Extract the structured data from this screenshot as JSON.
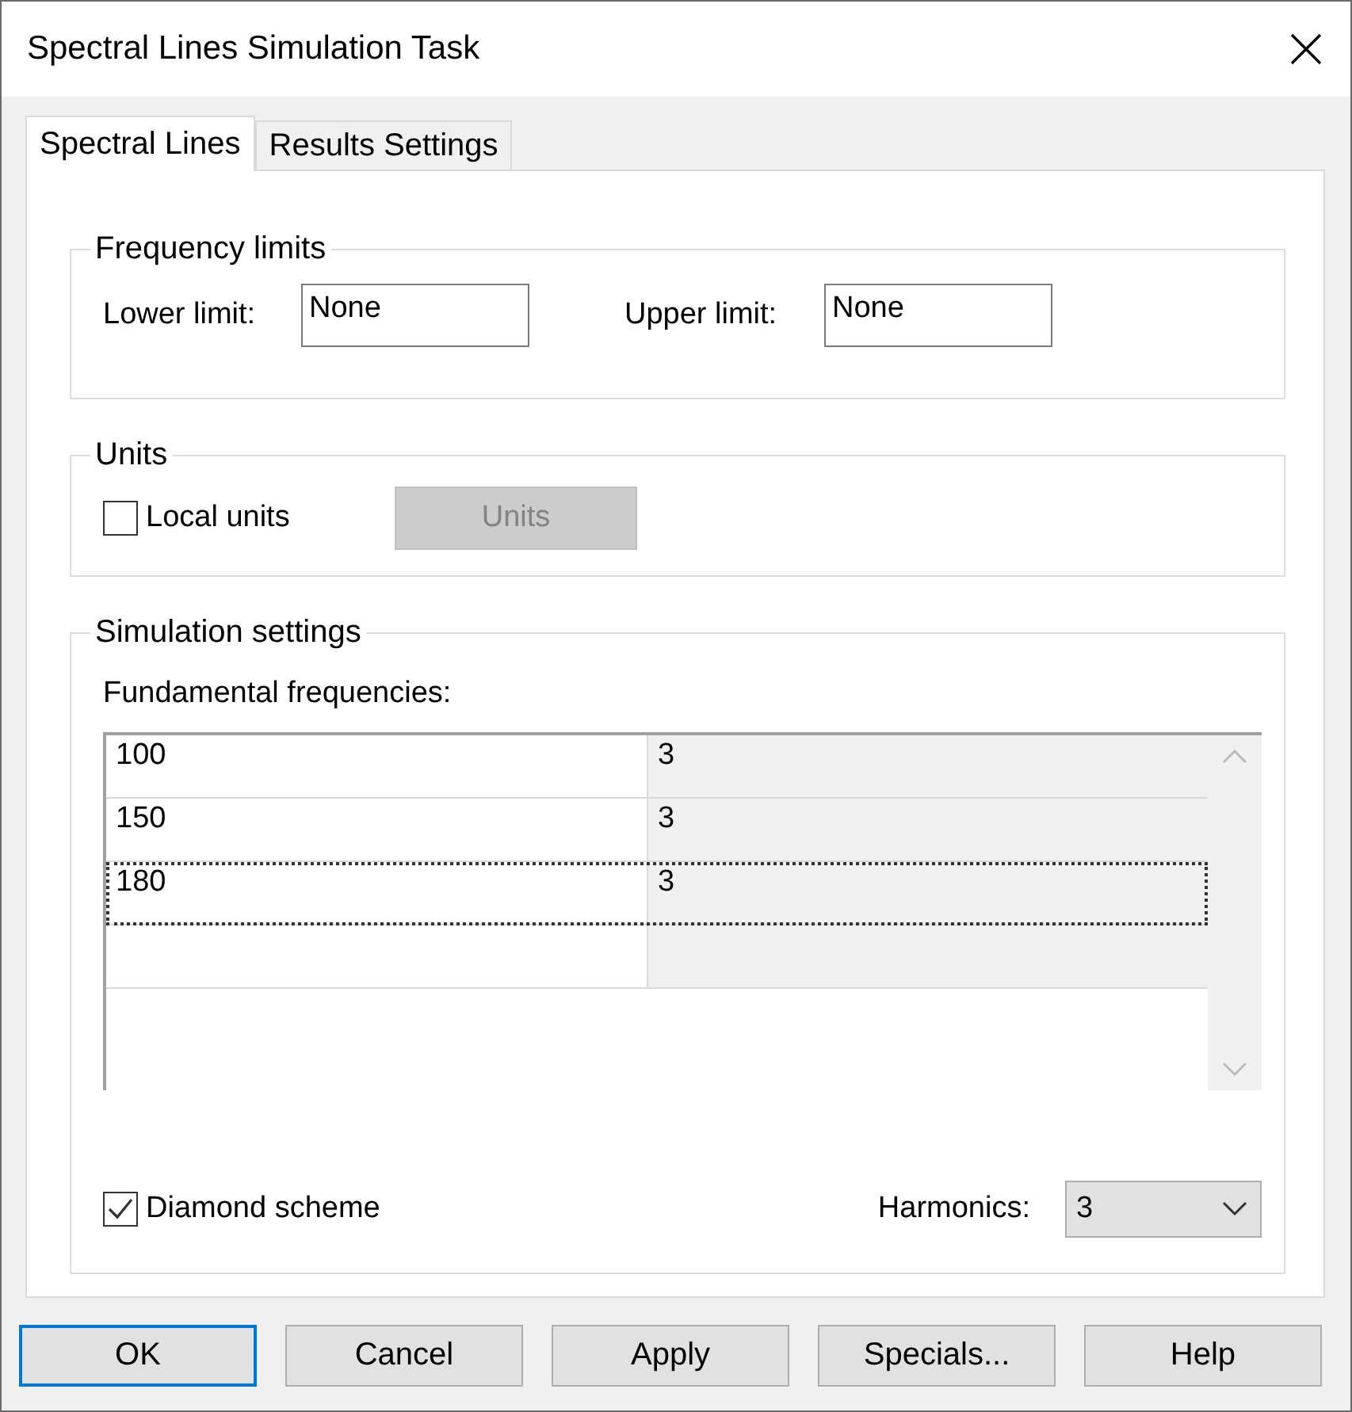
{
  "window": {
    "title": "Spectral Lines Simulation Task"
  },
  "tabs": [
    {
      "label": "Spectral Lines",
      "selected": true
    },
    {
      "label": "Results Settings",
      "selected": false
    }
  ],
  "frequency_limits": {
    "title": "Frequency limits",
    "lower_label": "Lower limit:",
    "lower_value": "None",
    "upper_label": "Upper limit:",
    "upper_value": "None"
  },
  "units": {
    "title": "Units",
    "local_units_label": "Local units",
    "local_units_checked": false,
    "units_button": "Units",
    "units_button_disabled": true
  },
  "simulation_settings": {
    "title": "Simulation settings",
    "table_label": "Fundamental frequencies:",
    "rows": [
      {
        "frequency": "100",
        "column_2": "3",
        "selected": false
      },
      {
        "frequency": "150",
        "column_2": "3",
        "selected": false
      },
      {
        "frequency": "180",
        "column_2": "3",
        "selected": true
      },
      {
        "frequency": "",
        "column_2": "",
        "selected": false
      }
    ],
    "diamond_label": "Diamond scheme",
    "diamond_checked": true,
    "harmonics_label": "Harmonics:",
    "harmonics_value": "3"
  },
  "buttons": [
    {
      "label": "OK",
      "default": true
    },
    {
      "label": "Cancel",
      "default": false
    },
    {
      "label": "Apply",
      "default": false
    },
    {
      "label": "Specials...",
      "default": false
    },
    {
      "label": "Help",
      "default": false
    }
  ]
}
